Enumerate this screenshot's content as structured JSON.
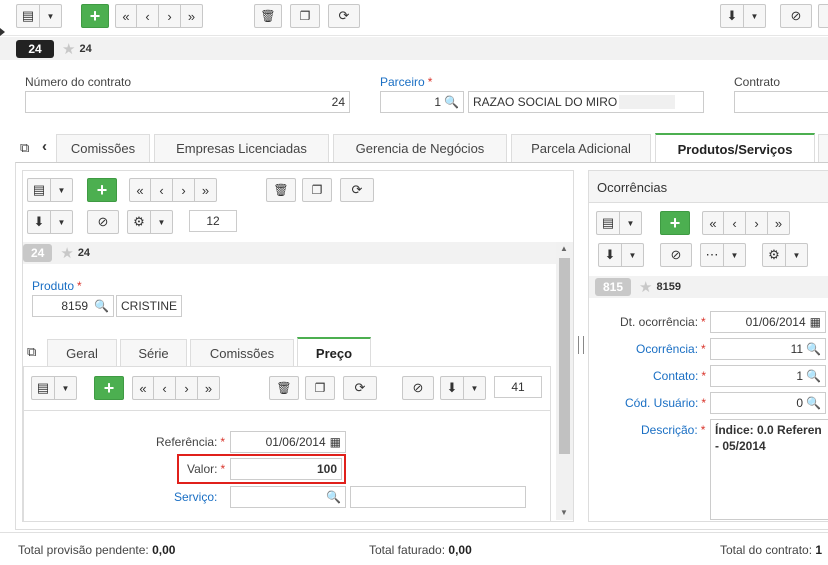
{
  "top_toolbar": {
    "counter": "24",
    "record_id": "24"
  },
  "header_fields": {
    "contract_number_label": "Número do contrato",
    "contract_number_value": "24",
    "partner_label": "Parceiro",
    "partner_code": "1",
    "partner_name": "RAZAO SOCIAL DO MIRO",
    "contract_label": "Contrato"
  },
  "main_tabs": [
    {
      "label": "Comissões"
    },
    {
      "label": "Empresas Licenciadas"
    },
    {
      "label": "Gerencia de Negócios"
    },
    {
      "label": "Parcela Adicional"
    },
    {
      "label": "Produtos/Serviços"
    }
  ],
  "products_panel": {
    "page_count": "12",
    "record_badge": "24",
    "record_id": "24",
    "product_label": "Produto",
    "product_code": "8159",
    "product_name": "CRISTINE",
    "sub_tabs": [
      {
        "label": "Geral"
      },
      {
        "label": "Série"
      },
      {
        "label": "Comissões"
      },
      {
        "label": "Preço"
      }
    ],
    "price": {
      "page_count": "41",
      "reference_label": "Referência:",
      "reference_value": "01/06/2014",
      "value_label": "Valor:",
      "value_value": "100",
      "service_label": "Serviço:"
    }
  },
  "occurrences_panel": {
    "title": "Ocorrências",
    "record_badge": "815",
    "record_id": "8159",
    "dt_label": "Dt. ocorrência:",
    "dt_value": "01/06/2014",
    "occ_label": "Ocorrência:",
    "occ_value": "11",
    "contact_label": "Contato:",
    "contact_value": "1",
    "user_label": "Cód. Usuário:",
    "user_value": "0",
    "desc_label": "Descrição:",
    "desc_line1": "Índice: 0.0 Referen",
    "desc_line2": "- 05/2014"
  },
  "footer": {
    "pending_label": "Total provisão pendente:",
    "pending_value": "0,00",
    "billed_label": "Total faturado:",
    "billed_value": "0,00",
    "contract_total_label": "Total do contrato:",
    "contract_total_value": "1"
  },
  "colors": {
    "accent_green": "#4caf50",
    "link_blue": "#1a6fc4",
    "required_red": "#d9342b",
    "highlight_red": "#e0201b"
  }
}
